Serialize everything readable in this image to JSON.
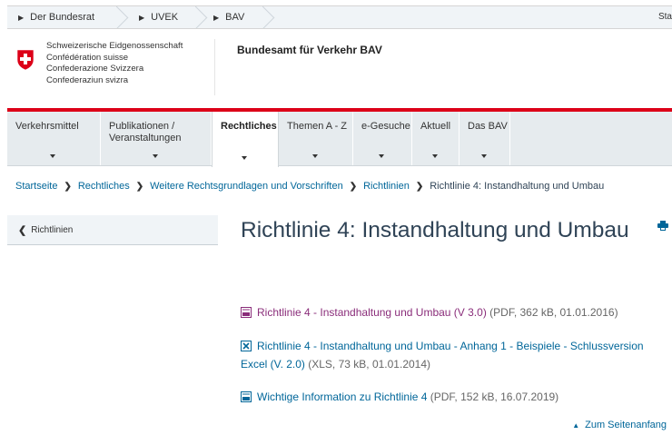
{
  "topbar": {
    "crumbs": [
      "Der Bundesrat",
      "UVEK",
      "BAV"
    ],
    "right_text": "Sta"
  },
  "header": {
    "confederation_lines": [
      "Schweizerische Eidgenossenschaft",
      "Confédération suisse",
      "Confederazione Svizzera",
      "Confederaziun svizra"
    ],
    "office_name": "Bundesamt für Verkehr BAV"
  },
  "nav": {
    "items": [
      {
        "label": "Verkehrsmittel"
      },
      {
        "label": "Publikationen / Veranstaltungen"
      },
      {
        "label": "Rechtliches",
        "active": true
      },
      {
        "label": "Themen A - Z"
      },
      {
        "label": "e-Gesuche"
      },
      {
        "label": "Aktuell"
      },
      {
        "label": "Das BAV"
      }
    ]
  },
  "breadcrumb": {
    "items": [
      "Startseite",
      "Rechtliches",
      "Weitere Rechtsgrundlagen und Vorschriften",
      "Richtlinien"
    ],
    "current": "Richtlinie 4: Instandhaltung und Umbau"
  },
  "sidebar": {
    "back_label": "Richtlinien"
  },
  "main": {
    "title": "Richtlinie 4: Instandhaltung und Umbau",
    "documents": [
      {
        "link": "Richtlinie 4 - Instandhaltung und Umbau (V 3.0)",
        "meta": " (PDF, 362 kB, 01.01.2016)",
        "icon": "pdf-icon"
      },
      {
        "link": "Richtlinie 4 - Instandhaltung und Umbau - Anhang 1 - Beispiele - Schlussversion Excel (V. 2.0)",
        "meta": " (XLS, 73 kB, 01.01.2014)",
        "icon": "excel-icon"
      },
      {
        "link": "Wichtige Information zu Richtlinie 4",
        "meta": " (PDF, 152 kB, 16.07.2019)",
        "icon": "pdf-icon"
      }
    ],
    "to_top": "Zum Seitenanfang"
  },
  "colors": {
    "brand_red": "#dc0018",
    "link_blue": "#006699",
    "visited_purple": "#8a2d7a",
    "text": "#2f4356"
  }
}
